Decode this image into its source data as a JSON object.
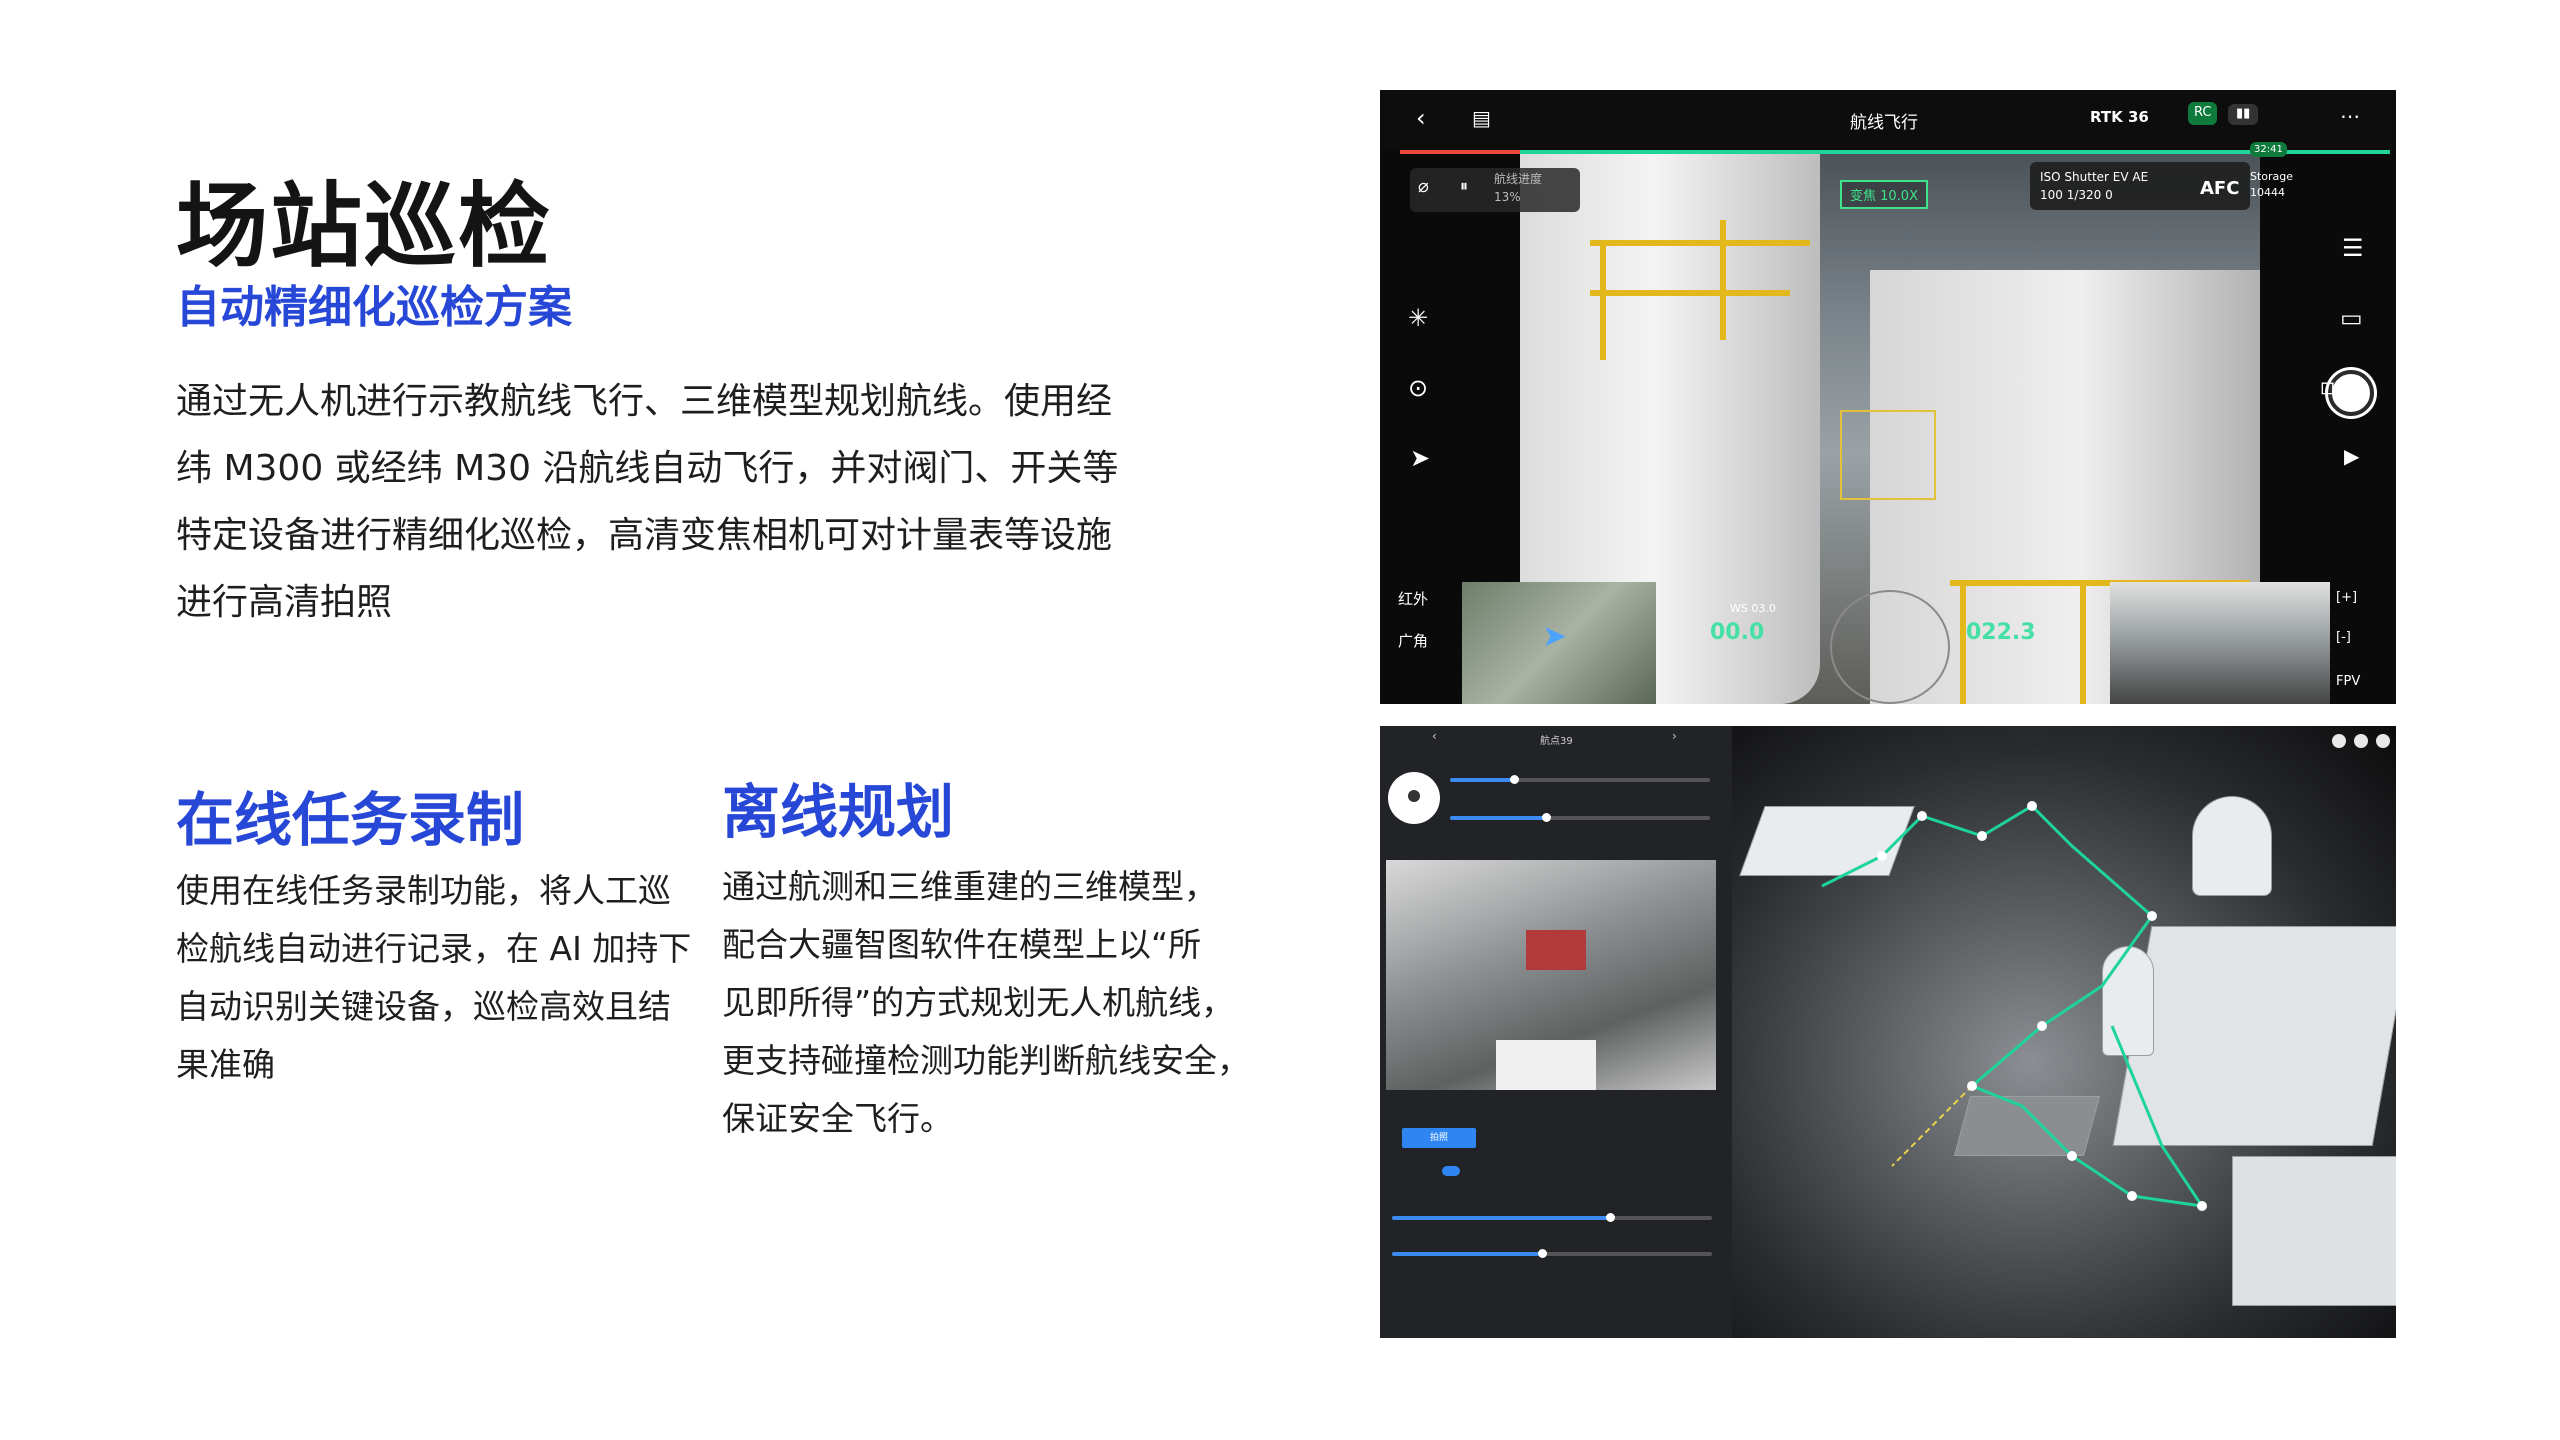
{
  "heading": {
    "title": "场站巡检",
    "subtitle": "自动精细化巡检方案",
    "intro_lines": [
      "通过无人机进行示教航线飞行、三维模型规划航线。使用经",
      "纬 M300 或经纬 M30 沿航线自动飞行，并对阀门、开关等",
      "特定设备进行精细化巡检，高清变焦相机可对计量表等设施",
      "进行高清拍照"
    ]
  },
  "sections": [
    {
      "title": "在线任务录制",
      "lines": [
        "使用在线任务录制功能，将人工巡",
        "检航线自动进行记录，在 AI 加持下",
        "自动识别关键设备，巡检高效且结",
        "果准确"
      ]
    },
    {
      "title": "离线规划",
      "lines": [
        "通过航测和三维重建的三维模型，",
        "配合大疆智图软件在模型上以“所",
        "见即所得”的方式规划无人机航线，",
        "更支持碰撞检测功能判断航线安全，",
        "保证安全飞行。"
      ]
    }
  ],
  "flight_ui": {
    "title": "航线飞行",
    "status": "RTK  36",
    "rc_badge": "RC",
    "progress_label": "航线进度",
    "progress_value": "13%",
    "zoom": "变焦 10.0X",
    "camera": {
      "headers": "ISO  Shutter  EV  AE",
      "values": "100  1/320   0   ",
      "mode": "AFC",
      "storage_label": "Storage",
      "storage_value": "10444"
    },
    "modes": [
      "红外",
      "广角"
    ],
    "fpv_label": "FPV",
    "ws": "WS 03.0",
    "speed": "00.0",
    "altitude": "022.3",
    "time": "32:41"
  },
  "planning_ui": {
    "panel_title": "航点39",
    "button_label": "拍照"
  },
  "colors": {
    "accent_blue": "#2747d6",
    "route_green": "#1ed49a",
    "zoom_green": "#3ee38b",
    "rail_yellow": "#e2b81b"
  }
}
